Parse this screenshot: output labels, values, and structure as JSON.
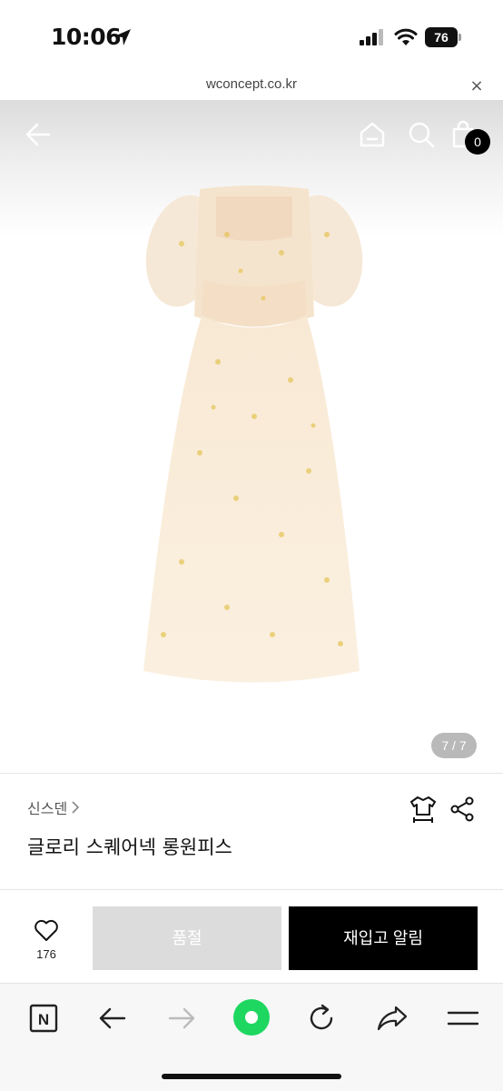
{
  "status_bar": {
    "time": "10:06",
    "battery_level": "76",
    "icons": [
      "location-arrow-icon",
      "signal-icon",
      "wifi-icon",
      "battery-icon"
    ]
  },
  "browser": {
    "url": "wconcept.co.kr",
    "close_symbol": "×"
  },
  "header": {
    "icons": [
      "back-arrow-icon",
      "home-icon",
      "search-icon",
      "shopping-bag-icon"
    ],
    "cart_count": "0"
  },
  "gallery": {
    "page_indicator": "7 / 7"
  },
  "product": {
    "brand": "신스덴",
    "name": "글로리 스퀘어넥 롱원피스",
    "icons": [
      "size-guide-icon",
      "share-icon"
    ]
  },
  "actions": {
    "wish_count": "176",
    "soldout_label": "품절",
    "restock_label": "재입고 알림"
  },
  "toolbar": {
    "icons": [
      "naver-n-icon",
      "back-icon",
      "forward-icon",
      "green-circle-icon",
      "reload-icon",
      "share-icon",
      "menu-icon"
    ],
    "n_letter": "N"
  },
  "colors": {
    "accent_green": "#1ed760",
    "button_dark": "#000000",
    "button_disabled": "#dcdcdc"
  }
}
